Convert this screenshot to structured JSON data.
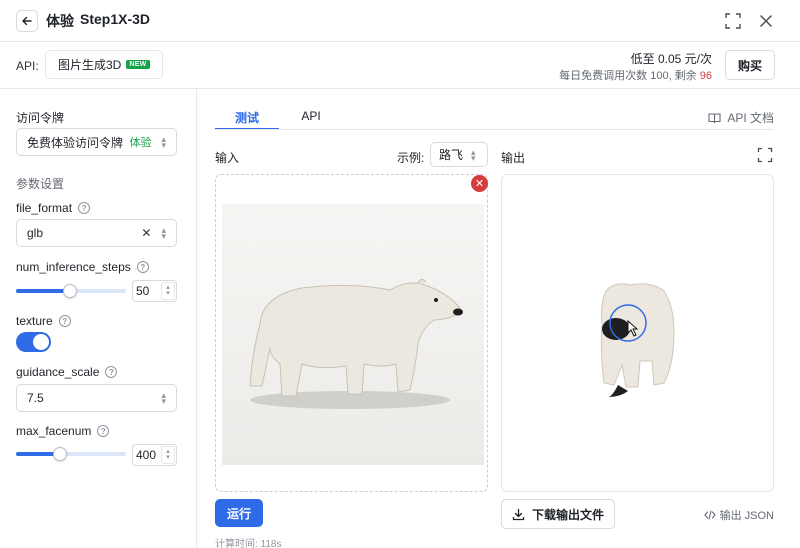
{
  "header": {
    "title": "体验",
    "model": "Step1X-3D"
  },
  "api_bar": {
    "label": "API:",
    "chip": "图片生成3D",
    "chip_badge": "NEW",
    "price": "低至 0.05 元/次",
    "quota_prefix": "每日免费调用次数 100, 剩余",
    "quota_remaining": "96",
    "buy": "购买"
  },
  "left": {
    "token_label": "访问令牌",
    "token_value": "免费体验访问令牌",
    "token_tag": "体验",
    "params_label": "参数设置",
    "file_format": {
      "label": "file_format",
      "value": "glb"
    },
    "num_inference_steps": {
      "label": "num_inference_steps",
      "value": "50",
      "fraction": 0.49
    },
    "texture": {
      "label": "texture",
      "enabled": true
    },
    "guidance_scale": {
      "label": "guidance_scale",
      "value": "7.5"
    },
    "max_facenum": {
      "label": "max_facenum",
      "value": "400",
      "fraction": 0.4
    }
  },
  "main": {
    "tabs": [
      {
        "label": "测试",
        "active": true
      },
      {
        "label": "API",
        "active": false
      }
    ],
    "docs": "API 文档",
    "input_label": "输入",
    "example_label": "示例:",
    "example_value": "路飞",
    "output_label": "输出",
    "run": "运行",
    "calc_time": "计算时间: 118s",
    "download": "下载输出文件",
    "output_json": "输出 JSON"
  },
  "colors": {
    "accent": "#2f6be6",
    "danger": "#d83b3b",
    "badge_green": "#16a34a"
  }
}
